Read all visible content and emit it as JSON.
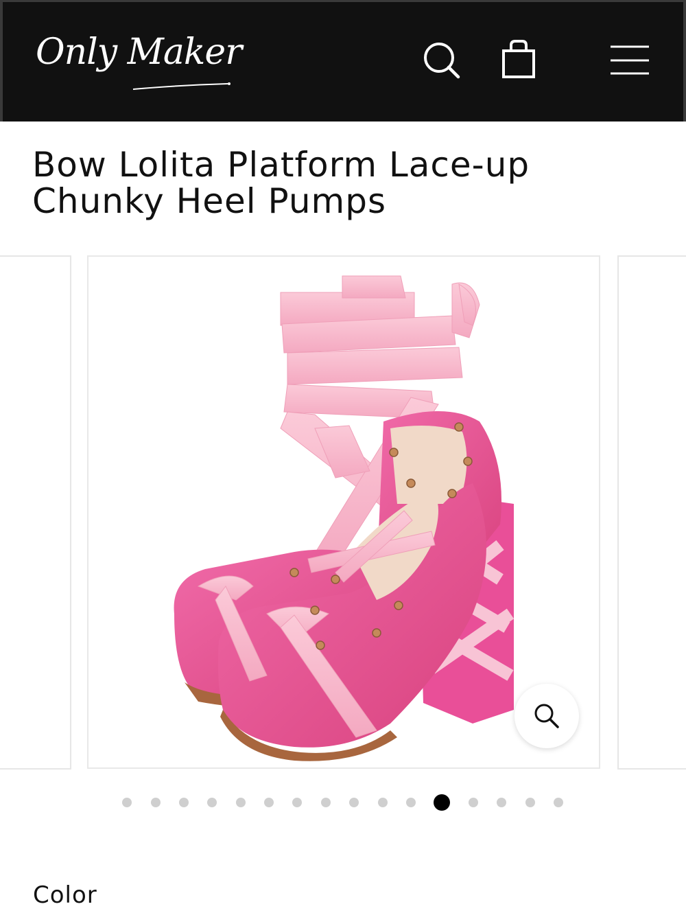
{
  "header": {
    "logo_text": "Only Maker",
    "icons": [
      "search-icon",
      "shopping-bag-icon",
      "hamburger-menu-icon"
    ],
    "background_color": "#111111"
  },
  "product": {
    "title": "Bow Lolita Platform Lace-up Chunky Heel Pumps",
    "image_subject": "pink-platform-shoes"
  },
  "gallery": {
    "slide_count": 16,
    "active_slide": 12,
    "zoom_icon": "zoom-magnifier-icon"
  },
  "options": {
    "color_label": "Color"
  },
  "colors": {
    "shoe_pink": "#e94f98",
    "ribbon_pink": "#f8b8cc",
    "dot_inactive": "#cfcfcf",
    "dot_active": "#000000"
  }
}
